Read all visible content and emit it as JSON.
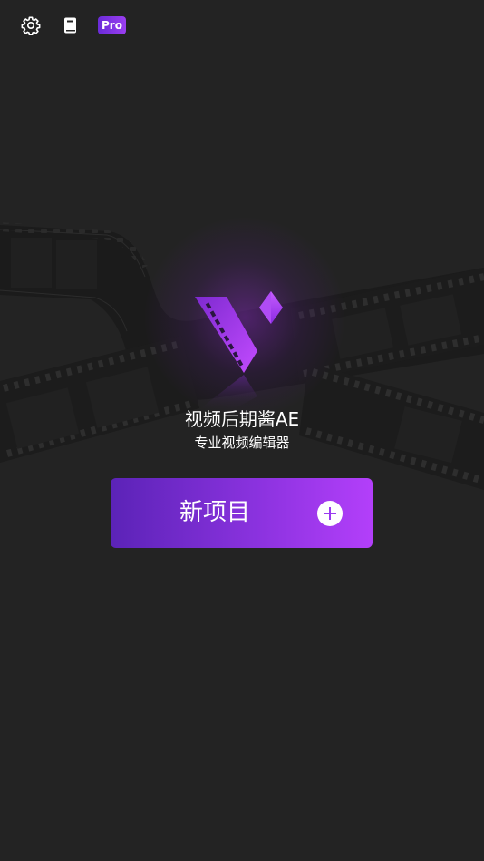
{
  "topbar": {
    "settings_icon": "gear-icon",
    "book_icon": "notebook-icon",
    "pro_label": "Pro"
  },
  "app": {
    "title": "视频后期酱AE",
    "subtitle": "专业视频编辑器"
  },
  "new_project": {
    "label": "新项目",
    "icon": "plus-circle-icon"
  },
  "colors": {
    "background": "#232323",
    "accent_start": "#5b23b7",
    "accent_end": "#b33ffa"
  }
}
